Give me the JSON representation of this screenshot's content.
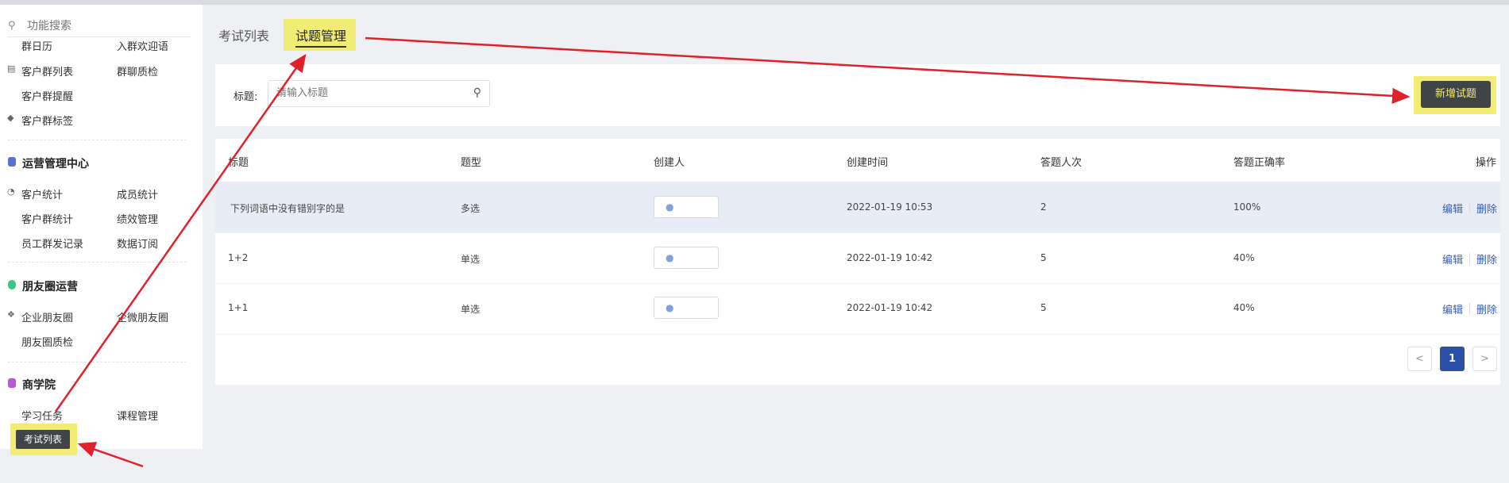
{
  "sidebar": {
    "search_placeholder": "功能搜索",
    "top_items": [
      "群日历",
      "入群欢迎语",
      "客户群列表",
      "群聊质检",
      "客户群提醒",
      "客户群标签"
    ],
    "groups": [
      {
        "title": "运营管理中心",
        "color": "#5b6fd8",
        "items": [
          "客户统计",
          "成员统计",
          "客户群统计",
          "绩效管理",
          "员工群发记录",
          "数据订阅"
        ]
      },
      {
        "title": "朋友圈运营",
        "color": "#3cc48a",
        "items": [
          "企业朋友圈",
          "企微朋友圈",
          "朋友圈质检"
        ]
      },
      {
        "title": "商学院",
        "color": "#b45ad8",
        "items": [
          "学习任务",
          "课程管理"
        ]
      }
    ],
    "active_item": "考试列表"
  },
  "tabs": {
    "exam_list": "考试列表",
    "question_mgmt": "试题管理"
  },
  "filter": {
    "title_label": "标题:",
    "title_placeholder": "请输入标题",
    "add_button": "新增试题"
  },
  "table": {
    "headers": [
      "标题",
      "题型",
      "创建人",
      "创建时间",
      "答题人次",
      "答题正确率",
      "操作"
    ],
    "rows": [
      {
        "title": "下列词语中没有错别字的是",
        "type": "多选",
        "creator": "",
        "created": "2022-01-19 10:53",
        "count": "2",
        "rate": "100%"
      },
      {
        "title": "1+2",
        "type": "单选",
        "creator": "",
        "created": "2022-01-19 10:42",
        "count": "5",
        "rate": "40%"
      },
      {
        "title": "1+1",
        "type": "单选",
        "creator": "",
        "created": "2022-01-19 10:42",
        "count": "5",
        "rate": "40%"
      }
    ],
    "edit_label": "编辑",
    "delete_label": "删除"
  },
  "pagination": {
    "prev": "<",
    "current": "1",
    "next": ">"
  },
  "colors": {
    "highlight": "#f3ec74",
    "arrow": "#e0202a",
    "primary": "#2c4fa8"
  }
}
